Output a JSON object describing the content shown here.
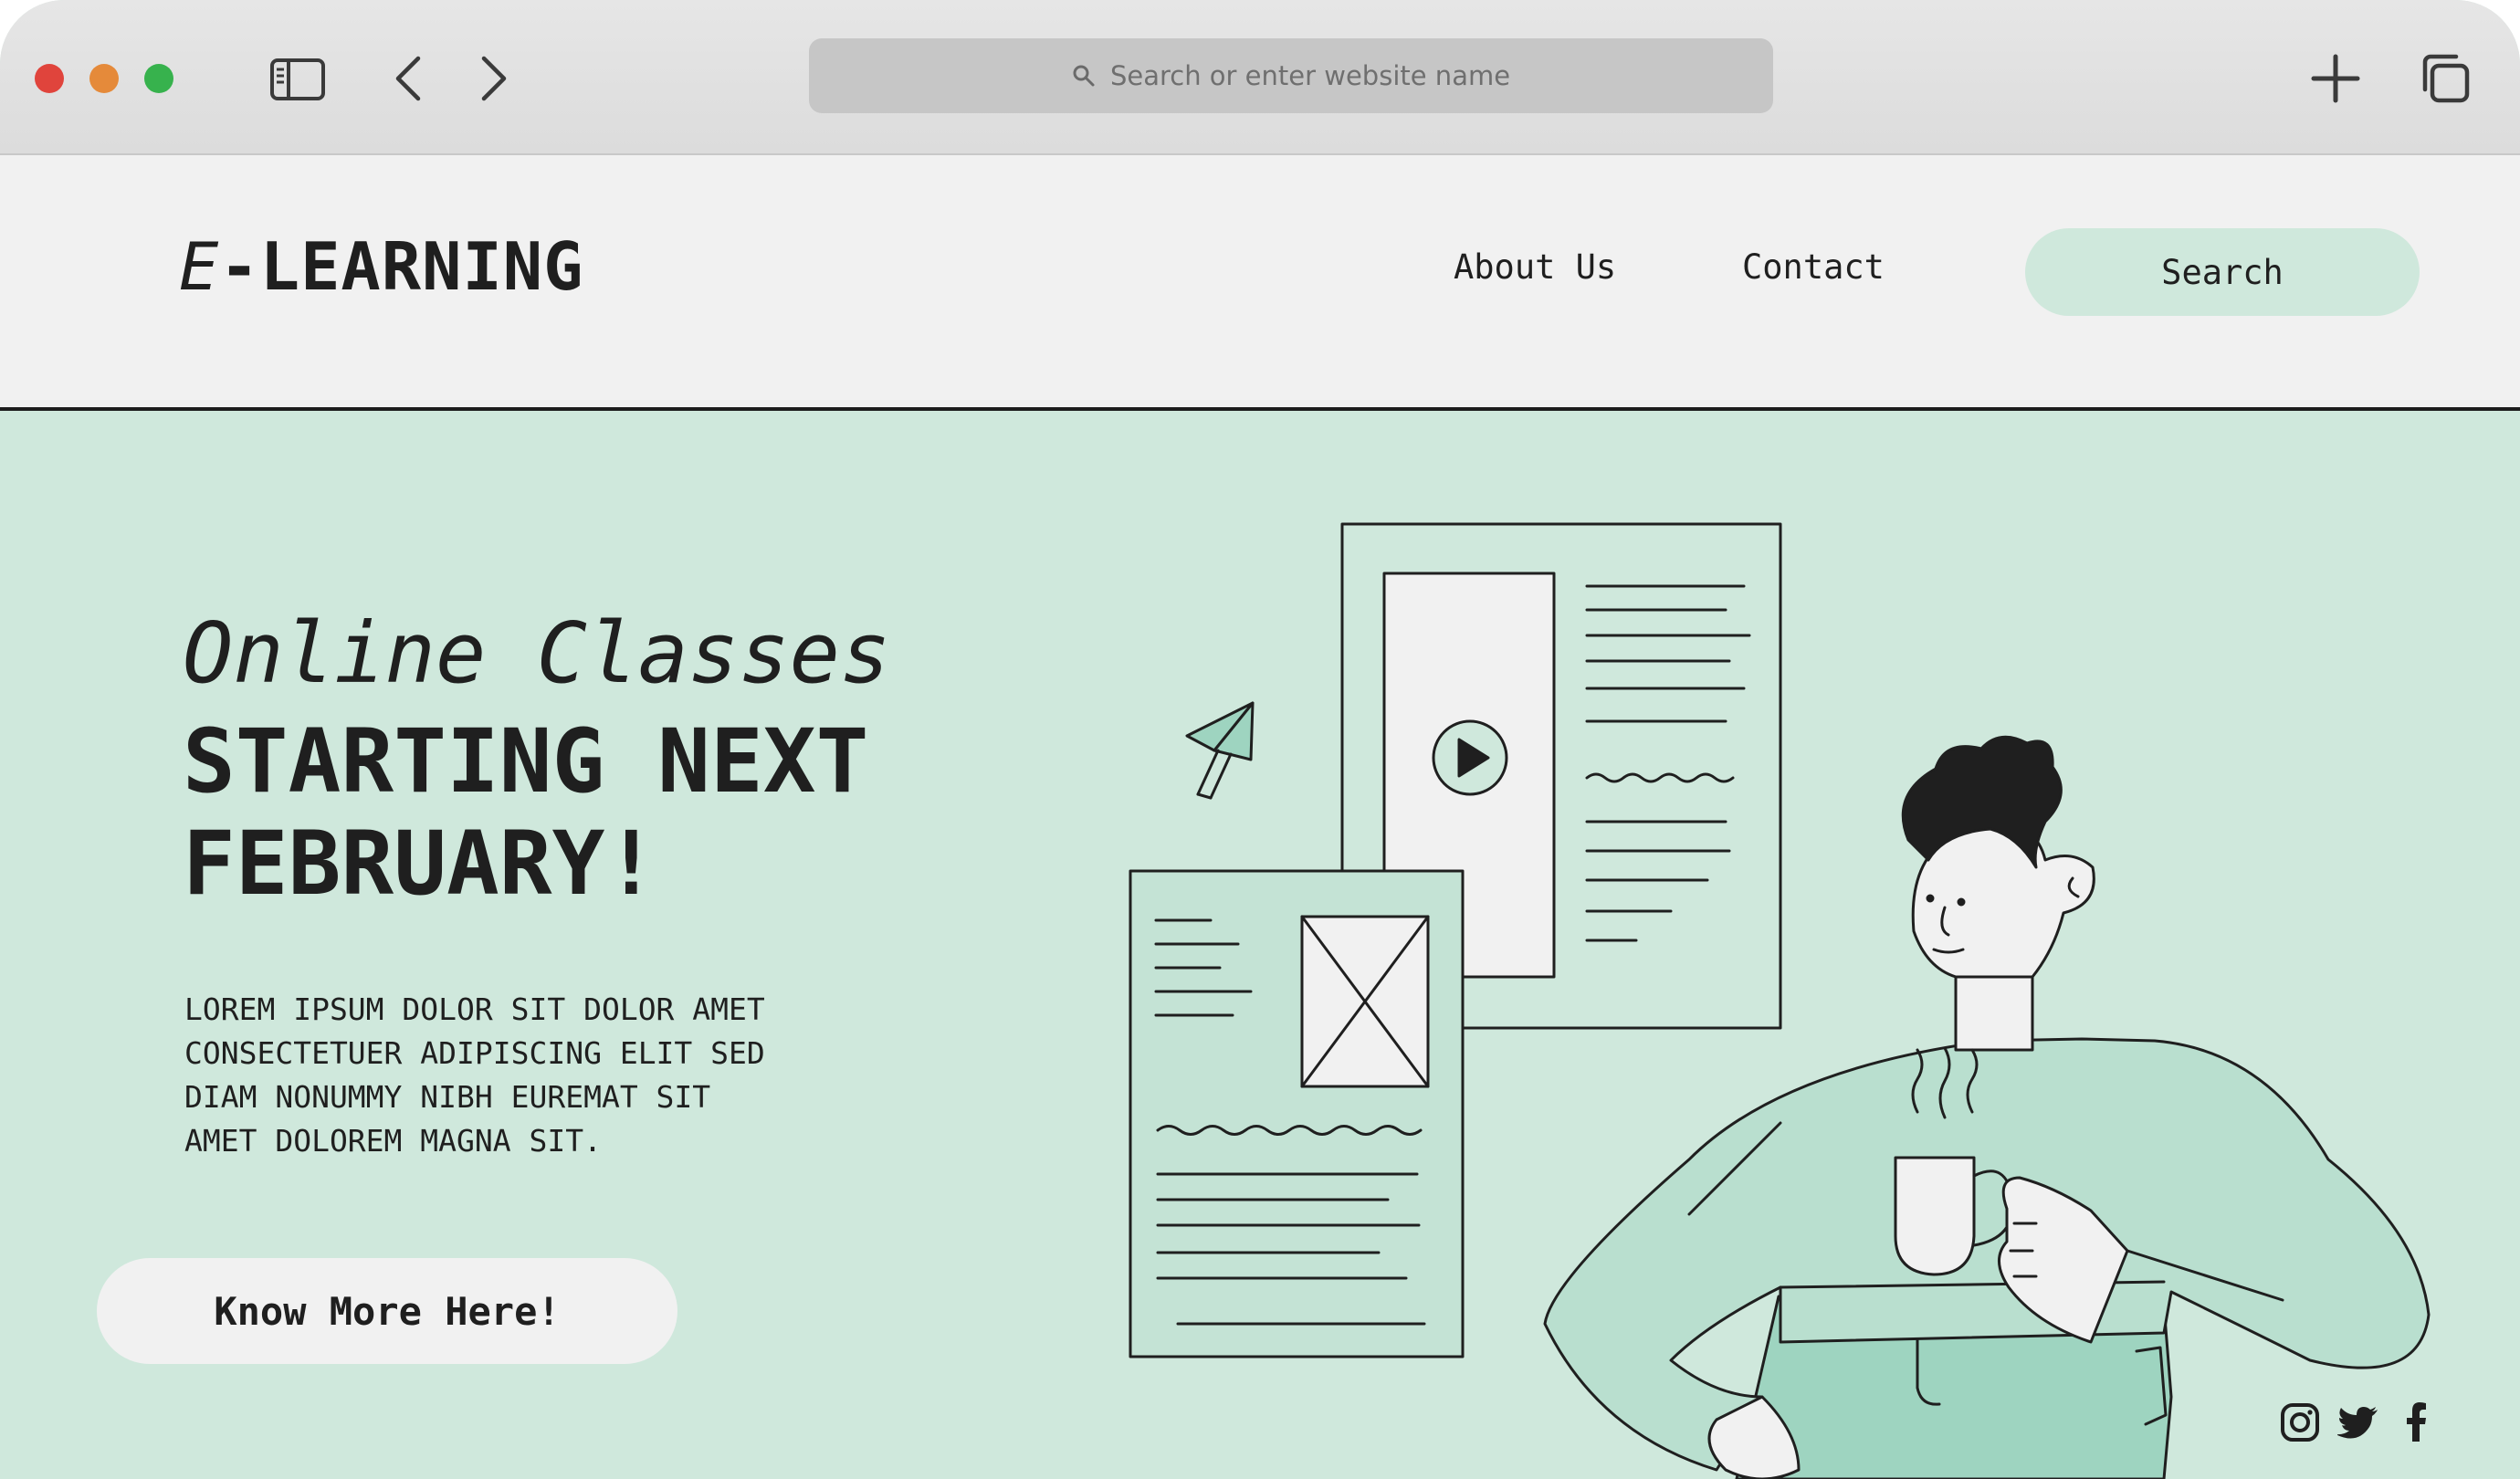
{
  "browser": {
    "address_placeholder": "Search or enter website name"
  },
  "header": {
    "logo_prefix": "E",
    "logo_sep": "-",
    "logo_name": "LEARNING",
    "nav": [
      "About Us",
      "Contact"
    ],
    "search_label": "Search"
  },
  "hero": {
    "title_italic": "Online Classes",
    "title_bold_1": "STARTING NEXT",
    "title_bold_2": "FEBRUARY!",
    "body_lines": [
      "LOREM IPSUM DOLOR SIT DOLOR AMET",
      "CONSECTETUER ADIPISCING ELIT SED",
      "DIAM NONUMMY NIBH EUREMAT SIT",
      "AMET DOLOREM MAGNA SIT."
    ],
    "cta_label": "Know More Here!"
  },
  "social": [
    "instagram-icon",
    "twitter-icon",
    "facebook-icon"
  ],
  "colors": {
    "mint": "#cfe8dc",
    "mint_dark": "#9ed4c0",
    "ink": "#1f1f1f",
    "header_bg": "#f1f1f1",
    "chrome_bg": "#dcdcdc"
  }
}
